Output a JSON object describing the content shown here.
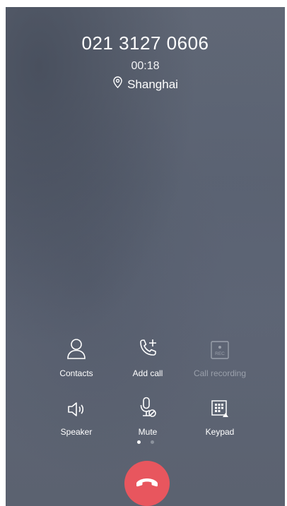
{
  "call": {
    "number": "021 3127 0606",
    "duration": "00:18",
    "location": "Shanghai"
  },
  "controls_row1": [
    {
      "label": "Contacts",
      "icon": "contacts-icon",
      "enabled": true
    },
    {
      "label": "Add call",
      "icon": "add-call-icon",
      "enabled": true
    },
    {
      "label": "Call recording",
      "icon": "rec-icon",
      "enabled": false
    }
  ],
  "controls_row2": [
    {
      "label": "Speaker",
      "icon": "speaker-icon",
      "enabled": true
    },
    {
      "label": "Mute",
      "icon": "mute-mic-icon",
      "enabled": true
    },
    {
      "label": "Keypad",
      "icon": "keypad-icon",
      "enabled": true
    }
  ],
  "rec_badge": "REC",
  "pager": {
    "pages": 2,
    "active": 1
  },
  "end_call": {
    "icon": "end-call-icon",
    "color": "#e8565e"
  }
}
